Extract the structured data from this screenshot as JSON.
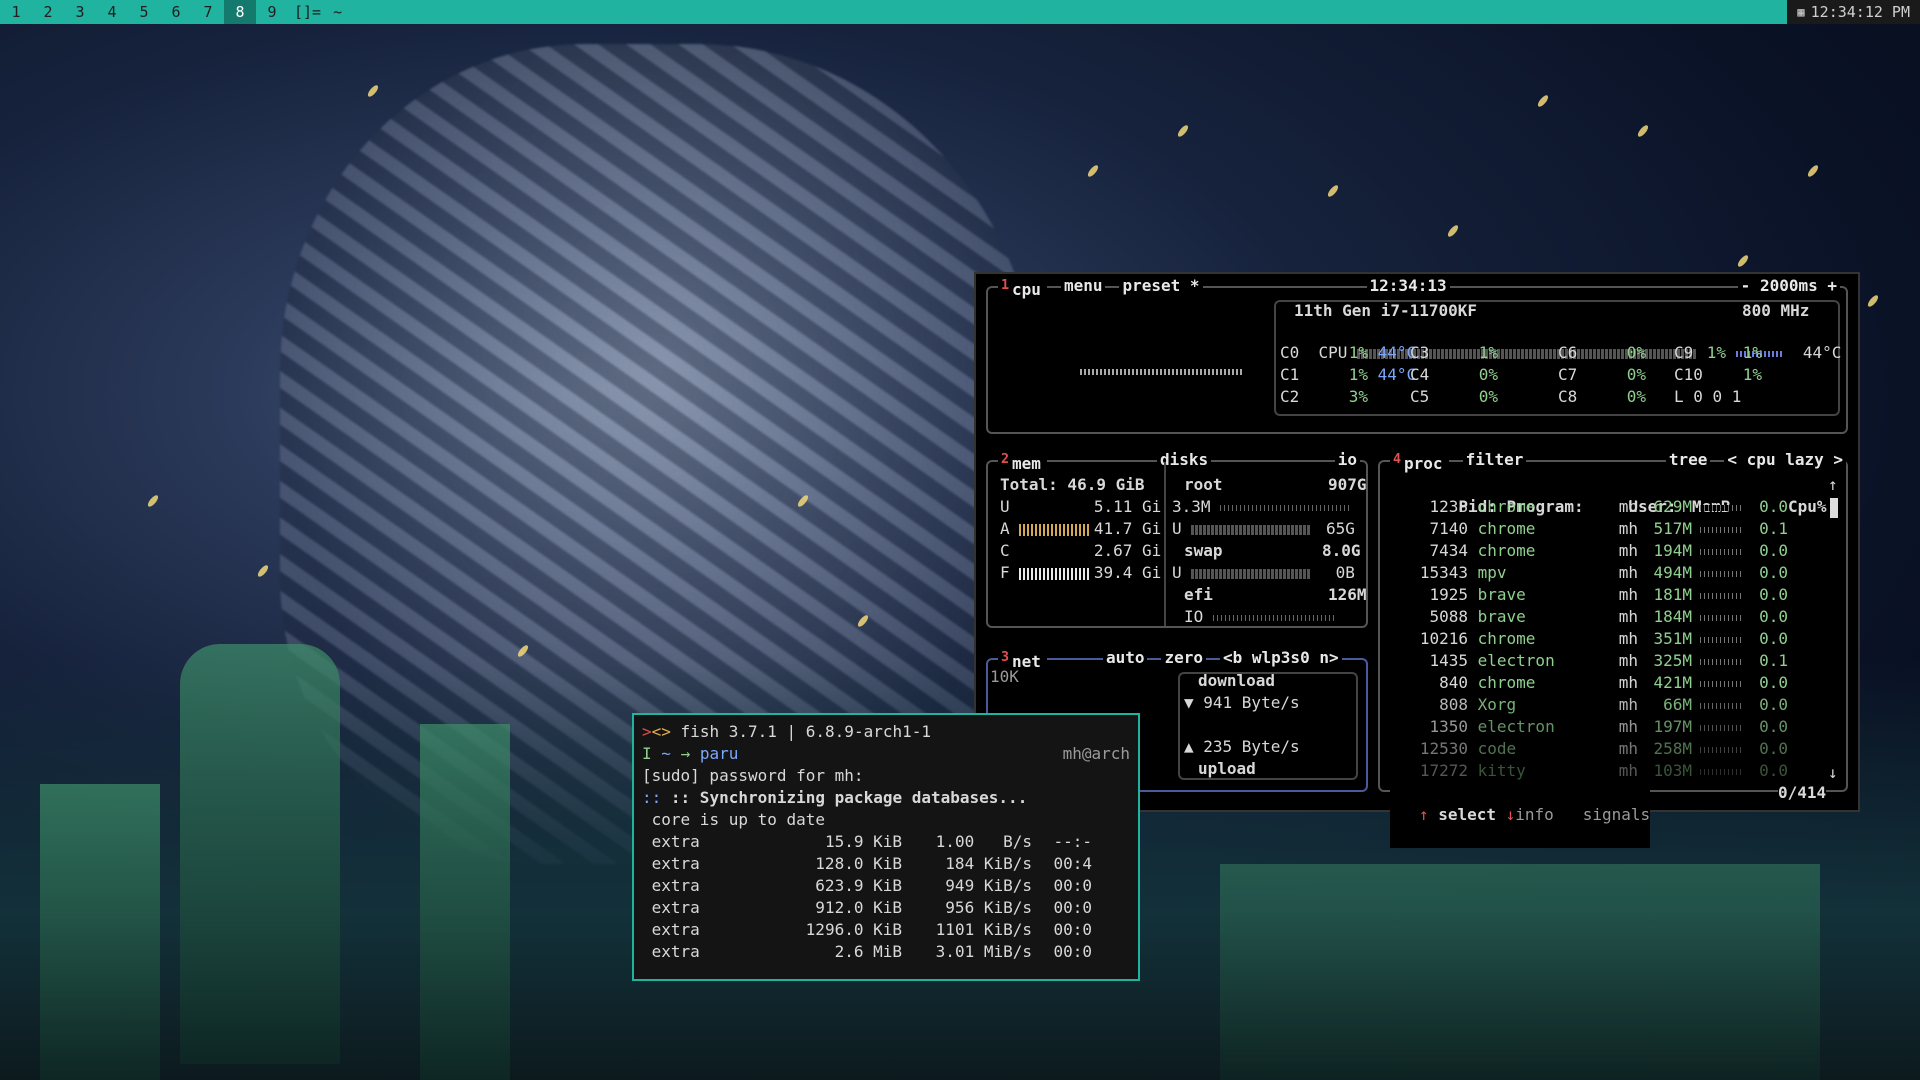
{
  "topbar": {
    "workspaces": [
      {
        "label": "1",
        "active": false
      },
      {
        "label": "2",
        "active": false
      },
      {
        "label": "3",
        "active": false
      },
      {
        "label": "4",
        "active": false
      },
      {
        "label": "5",
        "active": false
      },
      {
        "label": "6",
        "active": false
      },
      {
        "label": "7",
        "active": false
      },
      {
        "label": "8",
        "active": true
      },
      {
        "label": "9",
        "active": false
      }
    ],
    "layout": "[]=",
    "window_title": "~",
    "clock": "12:34:12 PM",
    "accent": "#1fb3a0"
  },
  "btop": {
    "cpu": {
      "tab_num": "1",
      "label": "cpu",
      "menu": "menu",
      "preset": "preset *",
      "time": "12:34:13",
      "interval": "- 2000ms +",
      "model": "11th Gen i7-11700KF",
      "freq": "800 MHz",
      "total_label": "CPU",
      "total_pct": "1%",
      "total_temp": "44°C",
      "cores": [
        {
          "name": "C0",
          "pct": "1%",
          "temp": "44°C"
        },
        {
          "name": "C1",
          "pct": "1%",
          "temp": "44°C"
        },
        {
          "name": "C2",
          "pct": "3%",
          "temp": ""
        },
        {
          "name": "C3",
          "pct": "1%",
          "temp": ""
        },
        {
          "name": "C4",
          "pct": "0%",
          "temp": ""
        },
        {
          "name": "C5",
          "pct": "0%",
          "temp": ""
        },
        {
          "name": "C6",
          "pct": "0%",
          "temp": ""
        },
        {
          "name": "C7",
          "pct": "0%",
          "temp": ""
        },
        {
          "name": "C8",
          "pct": "0%",
          "temp": ""
        },
        {
          "name": "C9",
          "pct": "1%",
          "temp": ""
        },
        {
          "name": "C10",
          "pct": "1%",
          "temp": ""
        }
      ],
      "load": "L 0 0 1"
    },
    "mem": {
      "tab_num": "2",
      "label": "mem",
      "total": "Total: 46.9 GiB",
      "rows": [
        {
          "k": "U",
          "v": "5.11 Gi"
        },
        {
          "k": "A",
          "v": "41.7 Gi"
        },
        {
          "k": "C",
          "v": "2.67 Gi"
        },
        {
          "k": "F",
          "v": "39.4 Gi"
        }
      ]
    },
    "disks": {
      "label": "disks",
      "io": "io",
      "root_name": "root",
      "root_size": "907G",
      "root_io": "3.3M",
      "root_used_label": "U",
      "root_used": "65G",
      "swap_name": "swap",
      "swap_size": "8.0G",
      "swap_used_label": "U",
      "swap_used": "0B",
      "efi_name": "efi",
      "efi_size": "126M",
      "efi_io": "IO"
    },
    "net": {
      "tab_num": "3",
      "label": "net",
      "auto": "auto",
      "zero": "zero",
      "iface": "<b wlp3s0 n>",
      "scale": "10K",
      "download_label": "download",
      "download": "▼ 941 Byte/s",
      "upload": "▲ 235 Byte/s",
      "upload_label": "upload"
    },
    "proc": {
      "tab_num": "4",
      "label": "proc",
      "filter": "filter",
      "tree": "tree",
      "sort": "< cpu lazy >",
      "headers": {
        "pid": "Pid:",
        "program": "Program:",
        "user": "User:",
        "mem": "MemB",
        "cpu": "Cpu%"
      },
      "rows": [
        {
          "pid": "1238",
          "program": "chrome",
          "user": "mh",
          "mem": "629M",
          "cpu": "0.0"
        },
        {
          "pid": "7140",
          "program": "chrome",
          "user": "mh",
          "mem": "517M",
          "cpu": "0.1"
        },
        {
          "pid": "7434",
          "program": "chrome",
          "user": "mh",
          "mem": "194M",
          "cpu": "0.0"
        },
        {
          "pid": "15343",
          "program": "mpv",
          "user": "mh",
          "mem": "494M",
          "cpu": "0.0"
        },
        {
          "pid": "1925",
          "program": "brave",
          "user": "mh",
          "mem": "181M",
          "cpu": "0.0"
        },
        {
          "pid": "5088",
          "program": "brave",
          "user": "mh",
          "mem": "184M",
          "cpu": "0.0"
        },
        {
          "pid": "10216",
          "program": "chrome",
          "user": "mh",
          "mem": "351M",
          "cpu": "0.0"
        },
        {
          "pid": "1435",
          "program": "electron",
          "user": "mh",
          "mem": "325M",
          "cpu": "0.1"
        },
        {
          "pid": "840",
          "program": "chrome",
          "user": "mh",
          "mem": "421M",
          "cpu": "0.0"
        },
        {
          "pid": "808",
          "program": "Xorg",
          "user": "mh",
          "mem": "66M",
          "cpu": "0.0"
        },
        {
          "pid": "1350",
          "program": "electron",
          "user": "mh",
          "mem": "197M",
          "cpu": "0.0"
        },
        {
          "pid": "12530",
          "program": "code",
          "user": "mh",
          "mem": "258M",
          "cpu": "0.0"
        },
        {
          "pid": "17272",
          "program": "kitty",
          "user": "mh",
          "mem": "103M",
          "cpu": "0.0"
        }
      ],
      "footer_select": "select",
      "footer_info": "info",
      "footer_signals": "signals",
      "count": "0/414"
    }
  },
  "terminal": {
    "title": "fish 3.7.1 | 6.8.9-arch1-1",
    "prompt_mode": "I",
    "prompt_path": "~",
    "prompt_cmd": "paru",
    "host": "mh@arch",
    "lines": [
      "[sudo] password for mh:",
      ":: Synchronizing package databases...",
      "core is up to date"
    ],
    "downloads": [
      {
        "repo": "extra",
        "size": "15.9 KiB",
        "rate": "1.00   B/s",
        "eta": "--:-"
      },
      {
        "repo": "extra",
        "size": "128.0 KiB",
        "rate": "184 KiB/s",
        "eta": "00:4"
      },
      {
        "repo": "extra",
        "size": "623.9 KiB",
        "rate": "949 KiB/s",
        "eta": "00:0"
      },
      {
        "repo": "extra",
        "size": "912.0 KiB",
        "rate": "956 KiB/s",
        "eta": "00:0"
      },
      {
        "repo": "extra",
        "size": "1296.0 KiB",
        "rate": "1101 KiB/s",
        "eta": "00:0"
      },
      {
        "repo": "extra",
        "size": "2.6 MiB",
        "rate": "3.01 MiB/s",
        "eta": "00:0"
      }
    ]
  }
}
